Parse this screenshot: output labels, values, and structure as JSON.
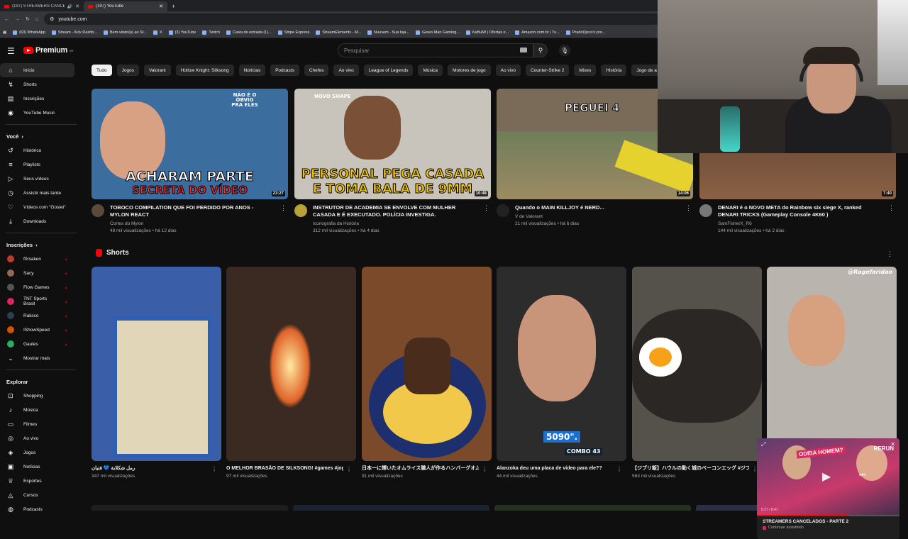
{
  "browser": {
    "tabs": [
      {
        "title": "(197) STREAMERS CANCELADOS",
        "active": false
      },
      {
        "title": "(197) YouTube",
        "active": true
      }
    ],
    "url": "youtube.com",
    "bookmarks": [
      "(63) WhatsApp",
      "Stream - Kick Dashb...",
      "Bem-vindo(a) ao St...",
      "X",
      "(3) YouTube",
      "Twitch",
      "Caixa de entrada (1)...",
      "Stripe Express",
      "StreamElements - M...",
      "Nuuvem - Sua loja...",
      "Green Man Gaming...",
      "KaBuM! | Ofertas e...",
      "Amazon.com.br | Tu...",
      "PradoDjeco's pro..."
    ]
  },
  "masthead": {
    "logo": "Premium",
    "logo_region": "BR",
    "search_placeholder": "Pesquisar"
  },
  "sidebar": {
    "main": [
      {
        "label": "Início",
        "icon": "home-icon",
        "active": true
      },
      {
        "label": "Shorts",
        "icon": "shorts-icon"
      },
      {
        "label": "Inscrições",
        "icon": "subscriptions-icon"
      },
      {
        "label": "YouTube Music",
        "icon": "music-icon"
      }
    ],
    "you_heading": "Você",
    "you": [
      {
        "label": "Histórico",
        "icon": "history-icon"
      },
      {
        "label": "Playlists",
        "icon": "playlist-icon"
      },
      {
        "label": "Seus vídeos",
        "icon": "your-videos-icon"
      },
      {
        "label": "Assistir mais tarde",
        "icon": "clock-icon"
      },
      {
        "label": "Vídeos com \"Gostei\"",
        "icon": "like-icon"
      },
      {
        "label": "Downloads",
        "icon": "download-icon"
      }
    ],
    "subs_heading": "Inscrições",
    "subs": [
      {
        "label": "f0rsaken",
        "color": "#c0392b"
      },
      {
        "label": "Sacy",
        "color": "#8e6d4e"
      },
      {
        "label": "Flow Games",
        "color": "#555555"
      },
      {
        "label": "TNT Sports Brasil",
        "color": "#e0245e"
      },
      {
        "label": "Ralisco",
        "color": "#2c3e50"
      },
      {
        "label": "IShowSpeed",
        "color": "#d35400"
      },
      {
        "label": "Gaules",
        "color": "#27ae60"
      }
    ],
    "show_more": "Mostrar mais",
    "explore_heading": "Explorar",
    "explore": [
      {
        "label": "Shopping",
        "icon": "shopping-icon"
      },
      {
        "label": "Música",
        "icon": "music-note-icon"
      },
      {
        "label": "Filmes",
        "icon": "film-icon"
      },
      {
        "label": "Ao vivo",
        "icon": "live-icon"
      },
      {
        "label": "Jogos",
        "icon": "gamepad-icon"
      },
      {
        "label": "Notícias",
        "icon": "news-icon"
      },
      {
        "label": "Esportes",
        "icon": "trophy-icon"
      },
      {
        "label": "Cursos",
        "icon": "courses-icon"
      },
      {
        "label": "Podcasts",
        "icon": "podcast-icon"
      }
    ]
  },
  "chips": [
    "Tudo",
    "Jogos",
    "Valorant",
    "Hollow Knight: Silksong",
    "Notícias",
    "Podcasts",
    "Chefes",
    "Ao vivo",
    "League of Legends",
    "Música",
    "Motores de jogo",
    "Ao vivo",
    "Counter-Strike 2",
    "Mixes",
    "História",
    "Jogo de a"
  ],
  "videos": [
    {
      "title": "TOBOCO COMPILATION QUE FOI PERDIDO POR ANOS - MYLON REACT",
      "channel": "Cortes do Mylon",
      "stats": "48 mil visualizações • há 12 dias",
      "duration": "23:27",
      "thumb_text": "ACHARAM PARTE",
      "thumb_text2": "SECRETA DO VÍDEO",
      "thumb_small": "NÃO É O ÓBVIO PRA ELES",
      "bg": "#3b6e9e",
      "avatar": "#5a4a3c"
    },
    {
      "title": "INSTRUTOR DE ACADEMIA SE ENVOLVE COM MULHER CASADA E É EXECUTADO. POLÍCIA INVESTIGA.",
      "channel": "Iconografia da História",
      "stats": "312 mil visualizações • há 4 dias",
      "duration": "10:48",
      "thumb_text": "PERSONAL PEGA CASADA",
      "thumb_text2": "E TOMA BALA DE 9MM",
      "thumb_small": "NOVO SHAPE",
      "bg": "#c8c4bc",
      "avatar": "#b8a135"
    },
    {
      "title": "Quando o MAIN KILLJOY é NERD...",
      "channel": "V de Valorant",
      "stats": "21 mil visualizações • há 6 dias",
      "duration": "14:06",
      "thumb_text": "PEGUEI 4",
      "bg": "#7a6a58",
      "avatar": "#222222"
    },
    {
      "title": "DENARI é o NOVO META do Rainbow six siege X, ranked DENARI TRICKS (Gameplay Console 4K60 )",
      "channel": "SamFisherX_R6",
      "stats": "144 mil visualizações • há 2 dias",
      "duration": "7:40",
      "bg": "#6b4a35",
      "avatar": "#777777"
    }
  ],
  "shorts_heading": "Shorts",
  "shorts": [
    {
      "title": "رمل شكلابة 💙 فتيان",
      "views": "347 mil visualizações",
      "bg": "#3a5ea8"
    },
    {
      "title": "O MELHOR BRASÃO DE SILKSONG! #games #jogos #gaming #silksong #hollowknight ...",
      "views": "97 mil visualizações",
      "bg": "#3a2a22"
    },
    {
      "title": "日本一に輝いたオムライス職人が作るハンバーグオムライス！#東京グルメ #japanesefood",
      "views": "91 mil visualizações",
      "bg": "#7a4a2a"
    },
    {
      "title": "Alanzoka deu uma placa de vídeo para ele??",
      "views": "44 mil visualizações",
      "bg": "#2c2c2c",
      "overlay": "5090\".",
      "overlay2": "COMBO 43"
    },
    {
      "title": "【ジブリ飯】ハウルの動く城のベーコンエッグ #ジブリ #amsr #camp #キャンプ飯 #...",
      "views": "563 mil visualizações",
      "bg": "#55514b"
    },
    {
      "title": "",
      "views": "",
      "bg": "#b9b4ae",
      "overlay": "@Ragefaridao"
    }
  ],
  "miniplayer": {
    "title": "STREAMERS CANCELADOS - PARTE 2",
    "status": "Continuar assistindo",
    "time": "5:37 / 8:41",
    "overlay": "ODEIA HOMEM?",
    "overlay2": "RERUN"
  }
}
